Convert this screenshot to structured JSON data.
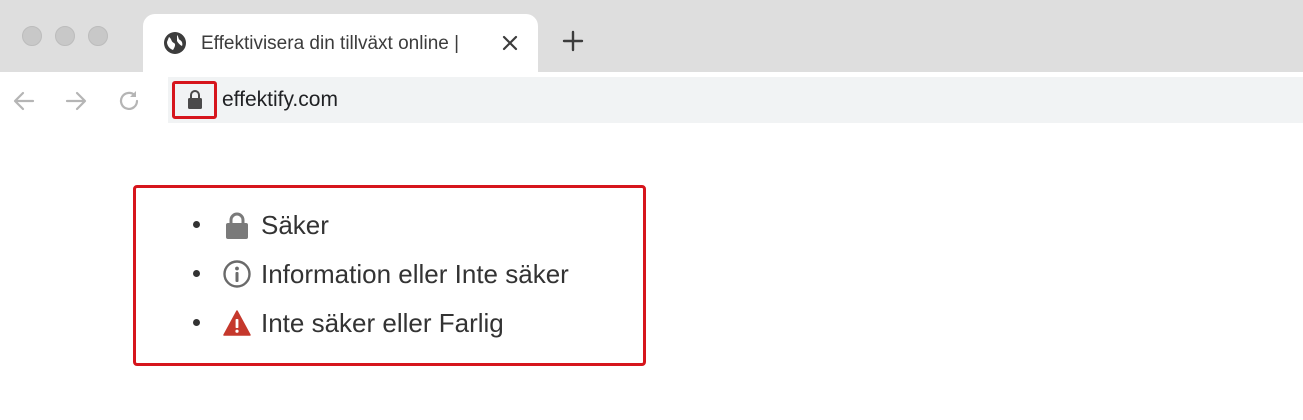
{
  "browser": {
    "tab": {
      "title": "Effektivisera din tillväxt online |",
      "favicon": "globe-icon",
      "close_icon": "close-icon"
    },
    "new_tab_icon": "plus-icon",
    "nav": {
      "back_icon": "arrow-left-icon",
      "forward_icon": "arrow-right-icon",
      "reload_icon": "reload-icon"
    },
    "omnibox": {
      "security_icon": "lock-icon",
      "url": "effektify.com"
    }
  },
  "legend": {
    "items": [
      {
        "icon": "lock-icon",
        "label": "Säker"
      },
      {
        "icon": "info-icon",
        "label": "Information eller Inte säker"
      },
      {
        "icon": "warning-icon",
        "label": "Inte säker eller Farlig"
      }
    ]
  },
  "colors": {
    "highlight": "#d6151c",
    "warning": "#c5382c",
    "icon_gray": "#7a7a7a"
  }
}
